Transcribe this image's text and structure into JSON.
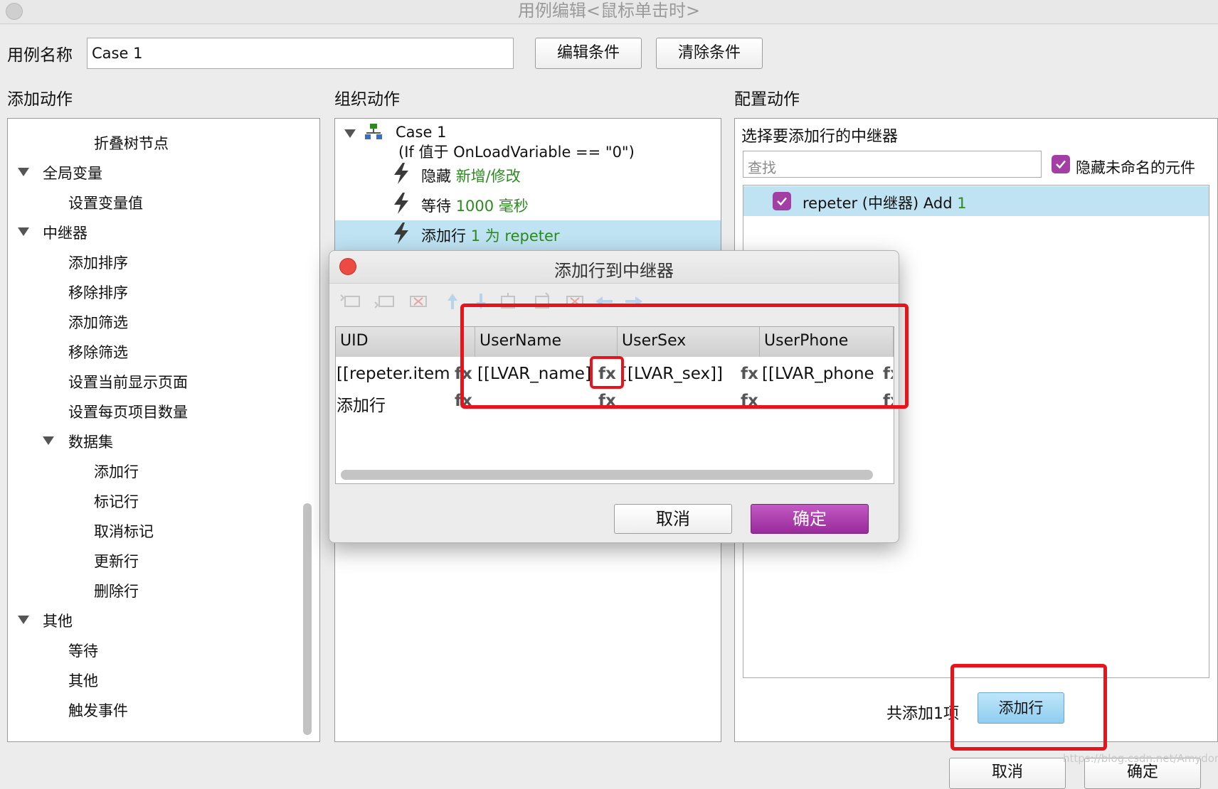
{
  "window": {
    "title": "用例编辑<鼠标单击时>"
  },
  "case_name": {
    "label": "用例名称",
    "value": "Case 1"
  },
  "buttons": {
    "edit_condition": "编辑条件",
    "clear_condition": "清除条件"
  },
  "sections": {
    "add_action": "添加动作",
    "organize_action": "组织动作",
    "configure_action": "配置动作"
  },
  "add_action_tree": {
    "collapse_node": "折叠树节点",
    "global_vars": "全局变量",
    "set_var": "设置变量值",
    "repeater": "中继器",
    "add_sort": "添加排序",
    "remove_sort": "移除排序",
    "add_filter": "添加筛选",
    "remove_filter": "移除筛选",
    "set_current_page": "设置当前显示页面",
    "set_items_per_page": "设置每页项目数量",
    "dataset": "数据集",
    "add_row": "添加行",
    "mark_row": "标记行",
    "unmark": "取消标记",
    "update_row": "更新行",
    "delete_row": "删除行",
    "other_group": "其他",
    "wait": "等待",
    "other": "其他",
    "trigger_event": "触发事件"
  },
  "organize": {
    "case_title": "Case 1",
    "case_condition": "(If 值于 OnLoadVariable == \"0\")",
    "actions": [
      {
        "verb": "隐藏",
        "target": "新增/修改"
      },
      {
        "verb": "等待",
        "target": "1000 毫秒"
      },
      {
        "verb": "添加行",
        "target": "1 为 repeter"
      }
    ]
  },
  "configure": {
    "heading": "选择要添加行的中继器",
    "search_placeholder": "查找",
    "hide_unnamed": "隐藏未命名的元件",
    "repeater_item": {
      "name": "repeter (中继器) Add",
      "count": "1"
    },
    "footer_text": "共添加1项",
    "add_row_button": "添加行"
  },
  "dialog": {
    "title": "添加行到中继器",
    "columns": [
      "UID",
      "UserName",
      "UserSex",
      "UserPhone"
    ],
    "rows": [
      [
        "[[repeter.item",
        "[[LVAR_name]",
        "[[LVAR_sex]]",
        "[[LVAR_phone"
      ],
      [
        "添加行",
        "",
        "",
        ""
      ]
    ],
    "fx_label": "fx",
    "cancel": "取消",
    "ok": "确定"
  },
  "bottom_buttons": {
    "cancel": "取消",
    "ok": "确定"
  },
  "watermark": "https://blog.csdn.net/Amydom",
  "colors": {
    "accent_purple": "#a23ea4",
    "highlight_red": "#e8131b",
    "selection_blue": "#bfe3f3",
    "value_green": "#2c8a1f"
  }
}
